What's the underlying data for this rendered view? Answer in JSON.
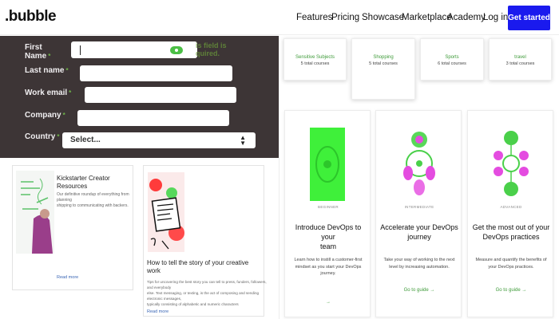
{
  "header": {
    "logo": ".bubble",
    "nav": [
      "Features",
      "Pricing",
      "Showcase",
      "Marketplace",
      "Academy"
    ],
    "login_label": "Log in",
    "cta_label": "Get started"
  },
  "form": {
    "first_name_label_line1": "First",
    "first_name_label_line2": "Name",
    "last_name_label": "Last name",
    "work_email_label": "Work email",
    "company_label": "Company",
    "country_label": "Country",
    "required_mark": "*",
    "ghost_text_line1": "is field is",
    "ghost_text_line2": "quired.",
    "country_value": "Select..."
  },
  "left_cards": [
    {
      "title": "Kickstarter Creator Resources",
      "desc_line1": "Our definitive roundup of everything from planning",
      "desc_line2": "shipping to communicating with backers.",
      "link": "Read more"
    },
    {
      "title": "How to tell the story of your creative work",
      "desc_line1": "Tips for uncovering the best story you can tell to press, funders, followers, and everybody",
      "desc_line2": "else. Text messaging, or texting, is the act of composing and sending electronic messages,",
      "desc_line3": "typically consisting of alphabetic and numeric characters",
      "link": "Read more"
    }
  ],
  "categories": [
    {
      "name": "Sensitive Subjects",
      "count": "5 total courses"
    },
    {
      "name": "Shopping",
      "count": "5 total courses"
    },
    {
      "name": "Sports",
      "count": "6 total courses"
    },
    {
      "name": "travel",
      "count": "3 total courses"
    }
  ],
  "guides": [
    {
      "level": "BEGINNER",
      "title_line1": "Introduce DevOps to your",
      "title_line2": "team",
      "desc_line1": "Learn how to instill a customer-first",
      "desc_line2": "mindset as you start your DevOps",
      "desc_line3": "journey.",
      "link": "→"
    },
    {
      "level": "INTERMEDIATE",
      "title_line1": "Accelerate your DevOps",
      "title_line2": "journey",
      "desc_line1": "Take your way of working to the next",
      "desc_line2": "level by increasing automation.",
      "link": "Go to guide →"
    },
    {
      "level": "ADVANCED",
      "title_line1": "Get the most out of your",
      "title_line2": "DevOps practices",
      "desc_line1": "Measure and quantify the benefits of",
      "desc_line2": "your DevOps practices.",
      "link": "Go to guide →"
    }
  ],
  "colors": {
    "brand_blue": "#1a1aee",
    "form_bg": "#3d3536",
    "accent_green": "#3f9b3a"
  }
}
